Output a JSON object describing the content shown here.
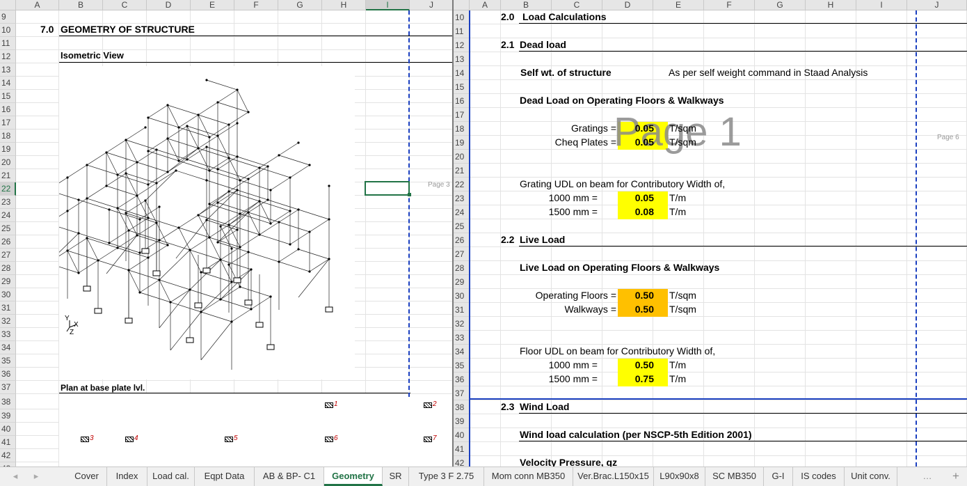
{
  "left": {
    "columns": [
      "A",
      "B",
      "C",
      "D",
      "E",
      "F",
      "G",
      "H",
      "I",
      "J"
    ],
    "rows": [
      "9",
      "10",
      "11",
      "12",
      "13",
      "14",
      "15",
      "16",
      "17",
      "18",
      "19",
      "20",
      "21",
      "22",
      "23",
      "24",
      "25",
      "26",
      "27",
      "28",
      "29",
      "30",
      "31",
      "32",
      "33",
      "34",
      "35",
      "36",
      "37",
      "38",
      "39",
      "40",
      "41",
      "42",
      "43"
    ],
    "section_number": "7.0",
    "section_title": "GEOMETRY OF STRUCTURE",
    "isometric_label": "Isometric View",
    "plan_label": "Plan at base plate lvl.",
    "page_label": "Page 3",
    "axis_labels": {
      "y": "Y",
      "x": "X",
      "z": "Z"
    },
    "plan_support_numbers": [
      "1",
      "2",
      "3",
      "4",
      "5",
      "6",
      "7"
    ],
    "selected_column": "I",
    "selected_row": "22"
  },
  "right": {
    "columns": [
      "A",
      "B",
      "C",
      "D",
      "E",
      "F",
      "G",
      "H",
      "I",
      "J"
    ],
    "rows": [
      "10",
      "11",
      "12",
      "13",
      "14",
      "15",
      "16",
      "17",
      "18",
      "19",
      "20",
      "21",
      "22",
      "23",
      "24",
      "25",
      "26",
      "27",
      "28",
      "29",
      "30",
      "31",
      "32",
      "33",
      "34",
      "35",
      "36",
      "37",
      "38",
      "39",
      "40",
      "41",
      "42"
    ],
    "s20_num": "2.0",
    "s20_title": "Load Calculations",
    "s21_num": "2.1",
    "s21_title": "Dead load",
    "self_wt_label": "Self wt. of structure",
    "self_wt_value": "As per self weight command in Staad Analysis",
    "dead_load_heading": "Dead Load on Operating Floors & Walkways",
    "gratings_label": "Gratings =",
    "gratings_value": "0.05",
    "gratings_unit": "T/sqm",
    "cheq_label": "Cheq Plates =",
    "cheq_value": "0.05",
    "cheq_unit": "T/sqm",
    "watermark": "Page 1",
    "page6_label": "Page 6",
    "grating_udl_heading": "Grating UDL on beam for Contributory Width of,",
    "g1000_label": "1000 mm =",
    "g1000_value": "0.05",
    "g1000_unit": "T/m",
    "g1500_label": "1500 mm =",
    "g1500_value": "0.08",
    "g1500_unit": "T/m",
    "s22_num": "2.2",
    "s22_title": "Live Load",
    "live_heading": "Live Load on Operating Floors & Walkways",
    "op_floor_label": "Operating Floors =",
    "op_floor_value": "0.50",
    "op_floor_unit": "T/sqm",
    "walkways_label": "Walkways =",
    "walkways_value": "0.50",
    "walkways_unit": "T/sqm",
    "floor_udl_heading": "Floor UDL on beam for Contributory Width of,",
    "f1000_label": "1000 mm =",
    "f1000_value": "0.50",
    "f1000_unit": "T/m",
    "f1500_label": "1500 mm =",
    "f1500_value": "0.75",
    "f1500_unit": "T/m",
    "s23_num": "2.3",
    "s23_title": "Wind Load",
    "wind_heading": "Wind load calculation (per NSCP-5th Edition 2001)",
    "velocity_heading": "Velocity Pressure, qz"
  },
  "tabs": [
    "Cover",
    "Index",
    "Load cal.",
    "Eqpt Data",
    "AB & BP- C1",
    "Geometry",
    "SR",
    "Type 3 F 2.75",
    "Mom conn MB350",
    "Ver.Brac.L150x15",
    "L90x90x8",
    "SC MB350",
    "G-I",
    "IS codes",
    "Unit conv."
  ],
  "active_tab": "Geometry",
  "tab_nav": {
    "prev": "◂",
    "next": "▸",
    "more": "…",
    "add": "+"
  },
  "colors": {
    "accent": "#217346",
    "highlight_yellow": "#ffff00",
    "highlight_orange": "#ffc000",
    "page_break": "#1a3fc0"
  }
}
